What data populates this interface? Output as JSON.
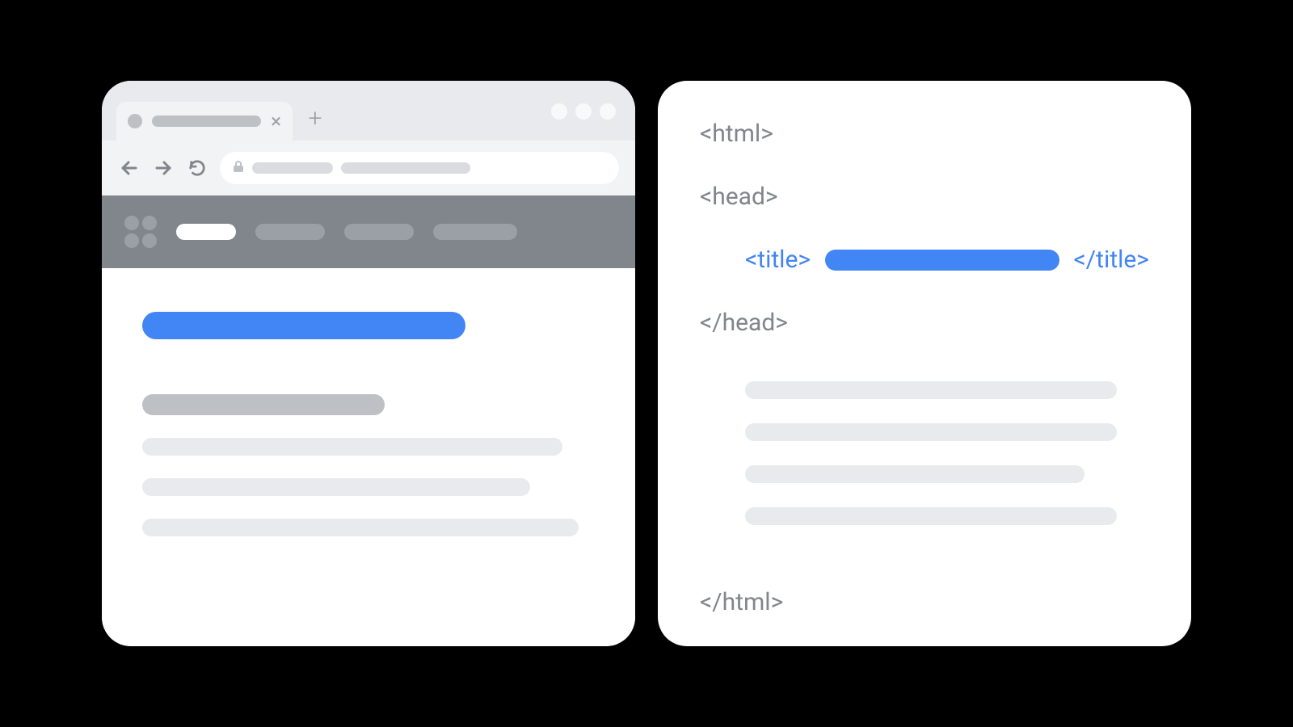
{
  "colors": {
    "accent_blue": "#4285f4",
    "grey_light": "#e8eaed",
    "grey_mid": "#bdc1c6",
    "grey_dark": "#80868b"
  },
  "browser": {
    "tab_close_glyph": "×",
    "new_tab_glyph": "+"
  },
  "code": {
    "html_open": "<html>",
    "head_open": "<head>",
    "title_open": "<title>",
    "title_close": "</title>",
    "head_close": "</head>",
    "html_close": "</html>"
  }
}
